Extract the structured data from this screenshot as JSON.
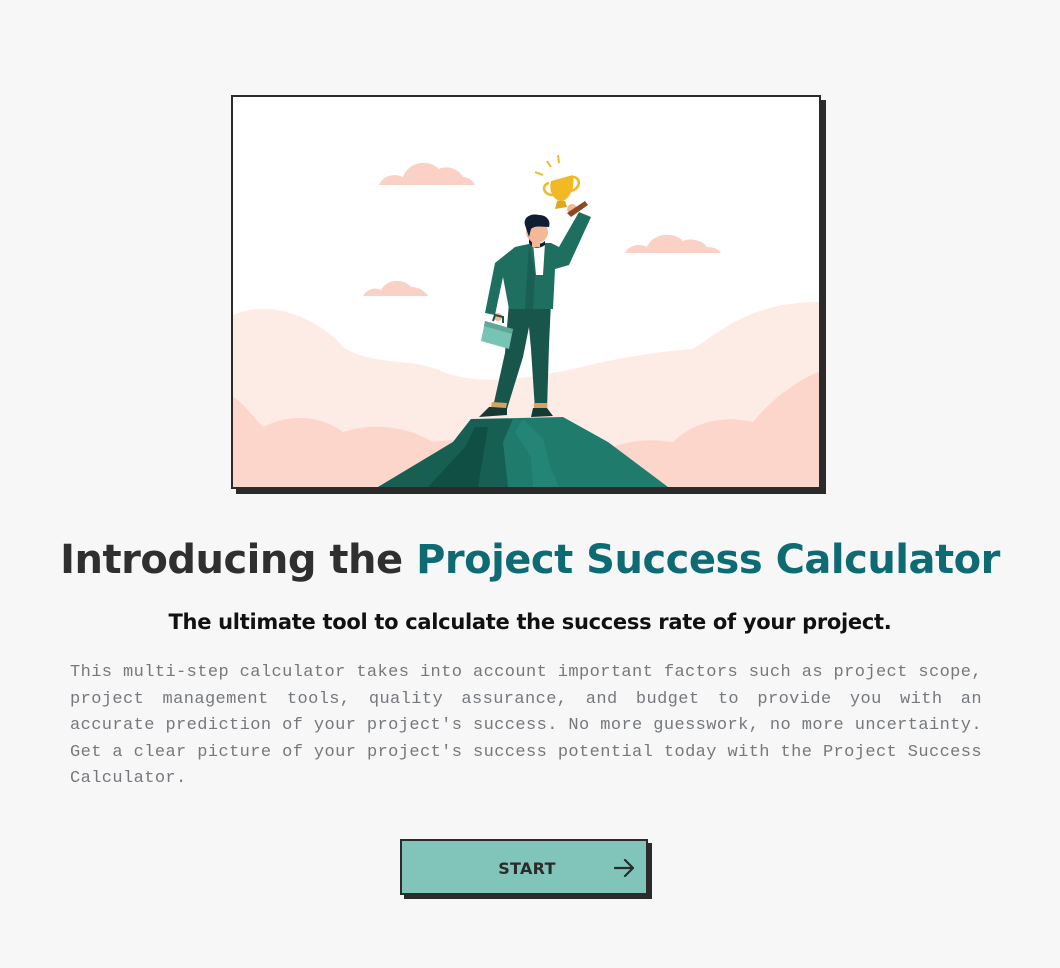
{
  "hero": {
    "image_name": "success-illustration"
  },
  "headline": {
    "lead": "Introducing the ",
    "accent": "Project Success Calculator",
    "accent_color": "#0f6b73"
  },
  "subheadline": "The ultimate tool to calculate the success rate of your project.",
  "description": "This multi-step calculator takes into account important factors such as project scope, project management tools, quality assurance, and budget to provide you with an accurate prediction of your project's success. No more guesswork, no more uncertainty. Get a clear picture of your project's success potential today with the Project Success Calculator.",
  "start_button": {
    "label": "START",
    "icon": "arrow-right-icon",
    "background_color": "#80c4ba"
  },
  "colors": {
    "page_background": "#f7f7f7",
    "border": "#2b2b2b"
  }
}
